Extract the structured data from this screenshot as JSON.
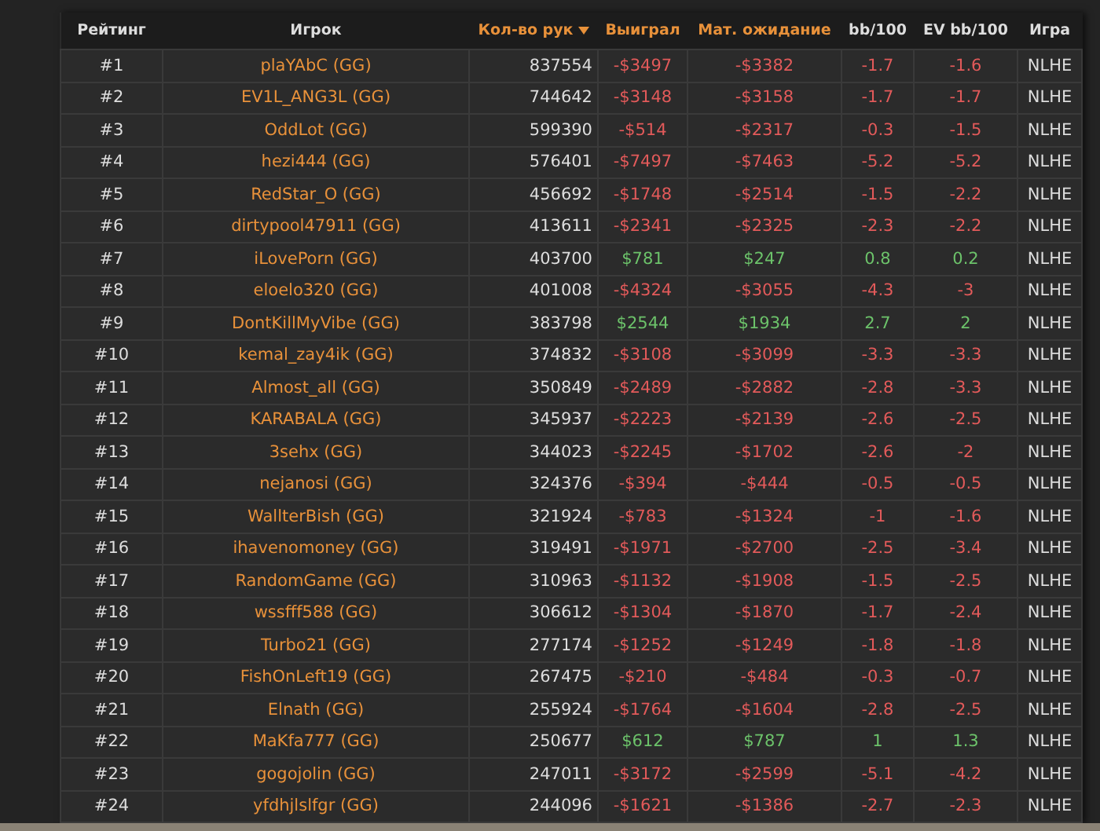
{
  "table": {
    "columns": [
      {
        "label": "Рейтинг",
        "sortable": false,
        "sorted": false
      },
      {
        "label": "Игрок",
        "sortable": false,
        "sorted": false
      },
      {
        "label": "Кол-во рук",
        "sortable": true,
        "sorted": true
      },
      {
        "label": "Выиграл",
        "sortable": true,
        "sorted": false
      },
      {
        "label": "Мат. ожидание",
        "sortable": true,
        "sorted": false
      },
      {
        "label": "bb/100",
        "sortable": false,
        "sorted": false
      },
      {
        "label": "EV bb/100",
        "sortable": false,
        "sorted": false
      },
      {
        "label": "Игра",
        "sortable": false,
        "sorted": false
      }
    ],
    "rows": [
      {
        "rank": "#1",
        "player": "plaYAbC (GG)",
        "hands": "837554",
        "won": "-$3497",
        "expected": "-$3382",
        "bb100": "-1.7",
        "ev_bb100": "-1.6",
        "game": "NLHE",
        "positive": false
      },
      {
        "rank": "#2",
        "player": "EV1L_ANG3L (GG)",
        "hands": "744642",
        "won": "-$3148",
        "expected": "-$3158",
        "bb100": "-1.7",
        "ev_bb100": "-1.7",
        "game": "NLHE",
        "positive": false
      },
      {
        "rank": "#3",
        "player": "OddLot (GG)",
        "hands": "599390",
        "won": "-$514",
        "expected": "-$2317",
        "bb100": "-0.3",
        "ev_bb100": "-1.5",
        "game": "NLHE",
        "positive": false
      },
      {
        "rank": "#4",
        "player": "hezi444 (GG)",
        "hands": "576401",
        "won": "-$7497",
        "expected": "-$7463",
        "bb100": "-5.2",
        "ev_bb100": "-5.2",
        "game": "NLHE",
        "positive": false
      },
      {
        "rank": "#5",
        "player": "RedStar_O (GG)",
        "hands": "456692",
        "won": "-$1748",
        "expected": "-$2514",
        "bb100": "-1.5",
        "ev_bb100": "-2.2",
        "game": "NLHE",
        "positive": false
      },
      {
        "rank": "#6",
        "player": "dirtypool47911 (GG)",
        "hands": "413611",
        "won": "-$2341",
        "expected": "-$2325",
        "bb100": "-2.3",
        "ev_bb100": "-2.2",
        "game": "NLHE",
        "positive": false
      },
      {
        "rank": "#7",
        "player": "iLovePorn (GG)",
        "hands": "403700",
        "won": "$781",
        "expected": "$247",
        "bb100": "0.8",
        "ev_bb100": "0.2",
        "game": "NLHE",
        "positive": true
      },
      {
        "rank": "#8",
        "player": "eloelo320 (GG)",
        "hands": "401008",
        "won": "-$4324",
        "expected": "-$3055",
        "bb100": "-4.3",
        "ev_bb100": "-3",
        "game": "NLHE",
        "positive": false
      },
      {
        "rank": "#9",
        "player": "DontKillMyVibe (GG)",
        "hands": "383798",
        "won": "$2544",
        "expected": "$1934",
        "bb100": "2.7",
        "ev_bb100": "2",
        "game": "NLHE",
        "positive": true
      },
      {
        "rank": "#10",
        "player": "kemal_zay4ik (GG)",
        "hands": "374832",
        "won": "-$3108",
        "expected": "-$3099",
        "bb100": "-3.3",
        "ev_bb100": "-3.3",
        "game": "NLHE",
        "positive": false
      },
      {
        "rank": "#11",
        "player": "Almost_all (GG)",
        "hands": "350849",
        "won": "-$2489",
        "expected": "-$2882",
        "bb100": "-2.8",
        "ev_bb100": "-3.3",
        "game": "NLHE",
        "positive": false
      },
      {
        "rank": "#12",
        "player": "KARABALA (GG)",
        "hands": "345937",
        "won": "-$2223",
        "expected": "-$2139",
        "bb100": "-2.6",
        "ev_bb100": "-2.5",
        "game": "NLHE",
        "positive": false
      },
      {
        "rank": "#13",
        "player": "3sehx (GG)",
        "hands": "344023",
        "won": "-$2245",
        "expected": "-$1702",
        "bb100": "-2.6",
        "ev_bb100": "-2",
        "game": "NLHE",
        "positive": false
      },
      {
        "rank": "#14",
        "player": "nejanosi (GG)",
        "hands": "324376",
        "won": "-$394",
        "expected": "-$444",
        "bb100": "-0.5",
        "ev_bb100": "-0.5",
        "game": "NLHE",
        "positive": false
      },
      {
        "rank": "#15",
        "player": "WallterBish (GG)",
        "hands": "321924",
        "won": "-$783",
        "expected": "-$1324",
        "bb100": "-1",
        "ev_bb100": "-1.6",
        "game": "NLHE",
        "positive": false
      },
      {
        "rank": "#16",
        "player": "ihavenomoney (GG)",
        "hands": "319491",
        "won": "-$1971",
        "expected": "-$2700",
        "bb100": "-2.5",
        "ev_bb100": "-3.4",
        "game": "NLHE",
        "positive": false
      },
      {
        "rank": "#17",
        "player": "RandomGame (GG)",
        "hands": "310963",
        "won": "-$1132",
        "expected": "-$1908",
        "bb100": "-1.5",
        "ev_bb100": "-2.5",
        "game": "NLHE",
        "positive": false
      },
      {
        "rank": "#18",
        "player": "wssfff588 (GG)",
        "hands": "306612",
        "won": "-$1304",
        "expected": "-$1870",
        "bb100": "-1.7",
        "ev_bb100": "-2.4",
        "game": "NLHE",
        "positive": false
      },
      {
        "rank": "#19",
        "player": "Turbo21 (GG)",
        "hands": "277174",
        "won": "-$1252",
        "expected": "-$1249",
        "bb100": "-1.8",
        "ev_bb100": "-1.8",
        "game": "NLHE",
        "positive": false
      },
      {
        "rank": "#20",
        "player": "FishOnLeft19 (GG)",
        "hands": "267475",
        "won": "-$210",
        "expected": "-$484",
        "bb100": "-0.3",
        "ev_bb100": "-0.7",
        "game": "NLHE",
        "positive": false
      },
      {
        "rank": "#21",
        "player": "Elnath (GG)",
        "hands": "255924",
        "won": "-$1764",
        "expected": "-$1604",
        "bb100": "-2.8",
        "ev_bb100": "-2.5",
        "game": "NLHE",
        "positive": false
      },
      {
        "rank": "#22",
        "player": "MaKfa777 (GG)",
        "hands": "250677",
        "won": "$612",
        "expected": "$787",
        "bb100": "1",
        "ev_bb100": "1.3",
        "game": "NLHE",
        "positive": true
      },
      {
        "rank": "#23",
        "player": "gogojolin (GG)",
        "hands": "247011",
        "won": "-$3172",
        "expected": "-$2599",
        "bb100": "-5.1",
        "ev_bb100": "-4.2",
        "game": "NLHE",
        "positive": false
      },
      {
        "rank": "#24",
        "player": "yfdhjlslfgr (GG)",
        "hands": "244096",
        "won": "-$1621",
        "expected": "-$1386",
        "bb100": "-2.7",
        "ev_bb100": "-2.3",
        "game": "NLHE",
        "positive": false
      }
    ]
  }
}
